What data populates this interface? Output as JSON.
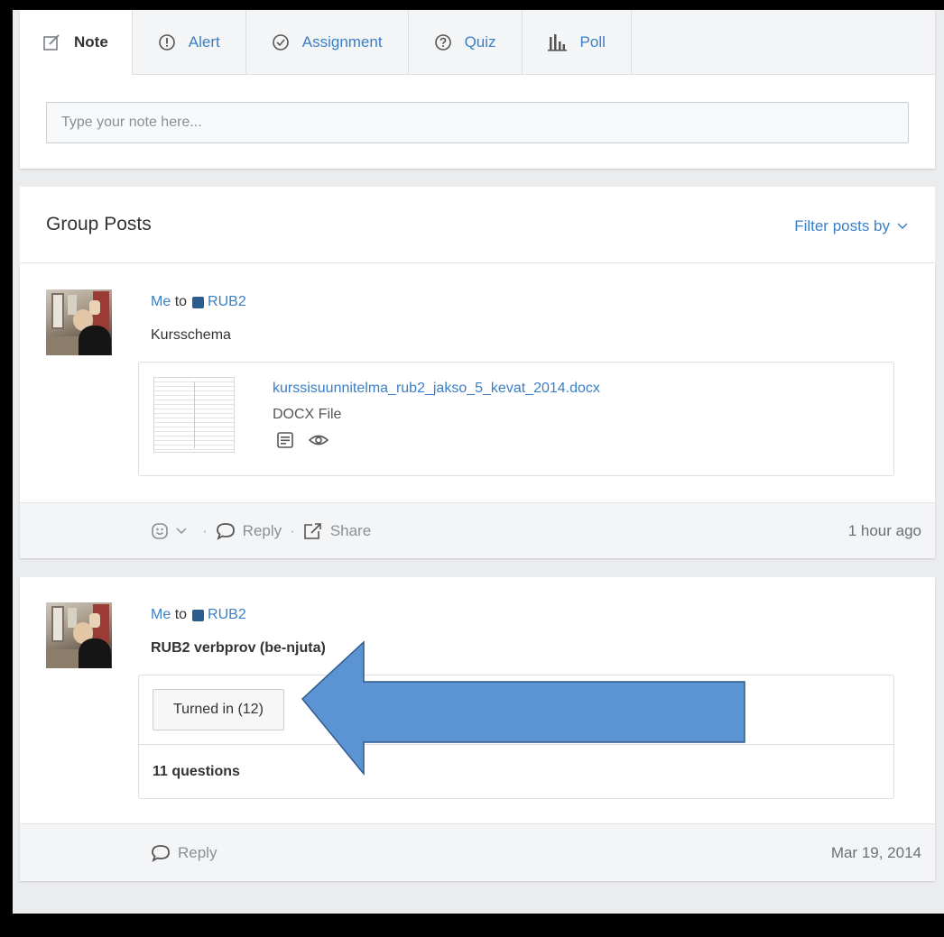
{
  "composer": {
    "tabs": [
      {
        "label": "Note",
        "icon": "note-edit-icon",
        "active": true
      },
      {
        "label": "Alert",
        "icon": "alert-icon",
        "active": false
      },
      {
        "label": "Assignment",
        "icon": "assignment-check-icon",
        "active": false
      },
      {
        "label": "Quiz",
        "icon": "quiz-question-icon",
        "active": false
      },
      {
        "label": "Poll",
        "icon": "poll-bars-icon",
        "active": false
      }
    ],
    "placeholder": "Type your note here..."
  },
  "group_posts": {
    "title": "Group Posts",
    "filter_label": "Filter posts by"
  },
  "posts": [
    {
      "author": "Me",
      "to": "to",
      "group": "RUB2",
      "text": "Kursschema",
      "attachment": {
        "file_name": "kurssisuunnitelma_rub2_jakso_5_kevat_2014.docx",
        "file_type": "DOCX File"
      },
      "actions": {
        "reply": "Reply",
        "share": "Share"
      },
      "timestamp": "1 hour ago"
    },
    {
      "author": "Me",
      "to": "to",
      "group": "RUB2",
      "text": "RUB2 verbprov (be-njuta)",
      "quiz": {
        "turned_in_label": "Turned in (12)",
        "questions_label": "11 questions"
      },
      "actions": {
        "reply": "Reply"
      },
      "timestamp": "Mar 19, 2014"
    }
  ],
  "colors": {
    "link": "#3a7fc6",
    "group_square": "#2c5d8f",
    "arrow_fill": "#5b93d3",
    "arrow_stroke": "#2f5b8e",
    "frame": "#000000"
  }
}
